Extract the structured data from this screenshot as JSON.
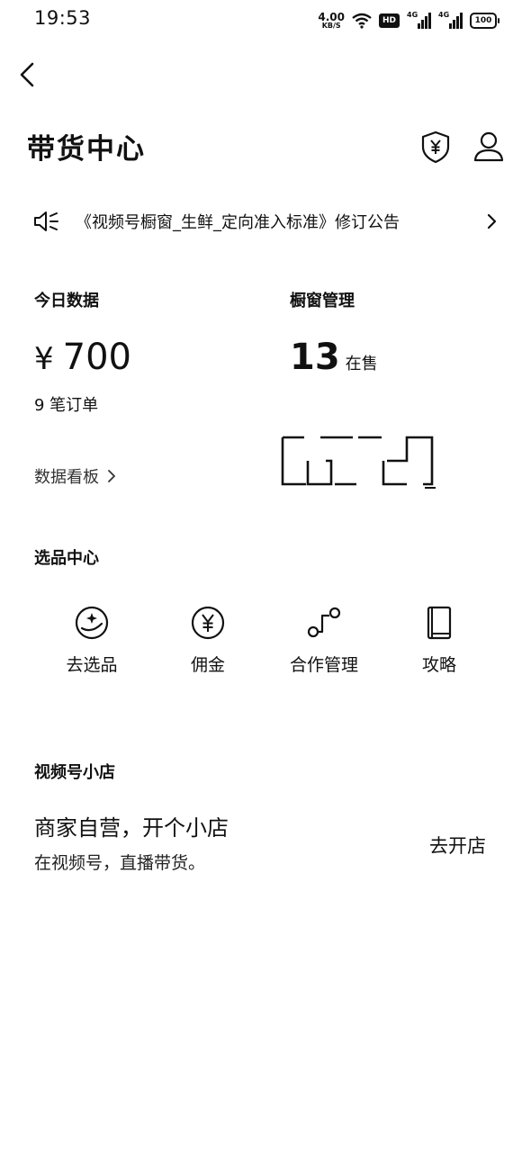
{
  "status_bar": {
    "time": "19:53",
    "net_speed_value": "4.00",
    "net_speed_unit": "KB/S",
    "hd_label": "HD",
    "sim1_label": "4G",
    "sim2_label": "4G",
    "battery": "100"
  },
  "header": {
    "title": "带货中心",
    "icons": [
      "back-icon",
      "shield-yen-icon",
      "user-icon"
    ]
  },
  "notice": {
    "text": "《视频号橱窗_生鲜_定向准入标准》修订公告"
  },
  "today": {
    "label": "今日数据",
    "currency": "¥",
    "amount": "700",
    "orders": "9 笔订单",
    "link": "数据看板"
  },
  "window": {
    "label": "橱窗管理",
    "count": "13",
    "count_unit": "在售"
  },
  "selection": {
    "label": "选品中心",
    "items": [
      {
        "label": "去选品",
        "icon": "select-product-icon"
      },
      {
        "label": "佣金",
        "icon": "commission-yen-icon"
      },
      {
        "label": "合作管理",
        "icon": "cooperation-icon"
      },
      {
        "label": "攻略",
        "icon": "guide-book-icon"
      }
    ]
  },
  "shop": {
    "section_label": "视频号小店",
    "title": "商家自营，开个小店",
    "subtitle": "在视频号，直播带货。",
    "button": "去开店"
  }
}
